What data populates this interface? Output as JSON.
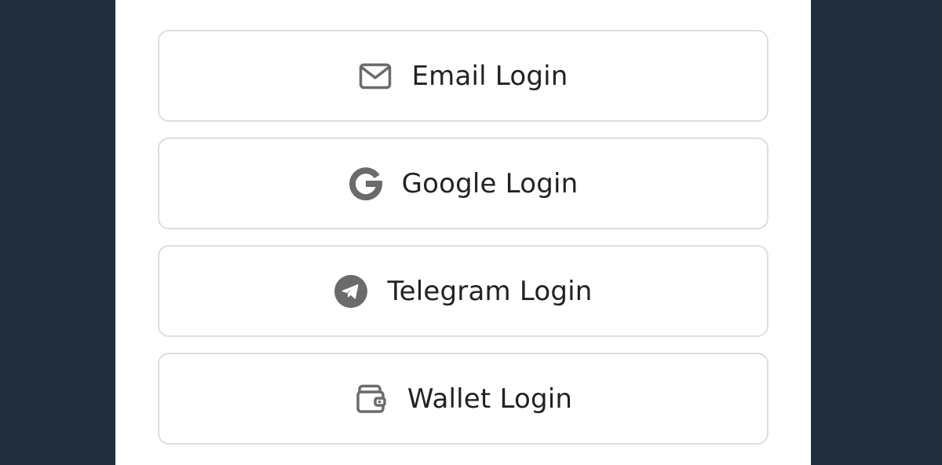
{
  "colors": {
    "background": "#1f2d3c",
    "panel": "#ffffff",
    "button_border": "#dedede",
    "icon": "#6b6b6b",
    "text": "#222222"
  },
  "login_options": [
    {
      "label": "Email Login",
      "icon": "mail-icon"
    },
    {
      "label": "Google Login",
      "icon": "google-icon"
    },
    {
      "label": "Telegram Login",
      "icon": "telegram-icon"
    },
    {
      "label": "Wallet Login",
      "icon": "wallet-icon"
    }
  ]
}
